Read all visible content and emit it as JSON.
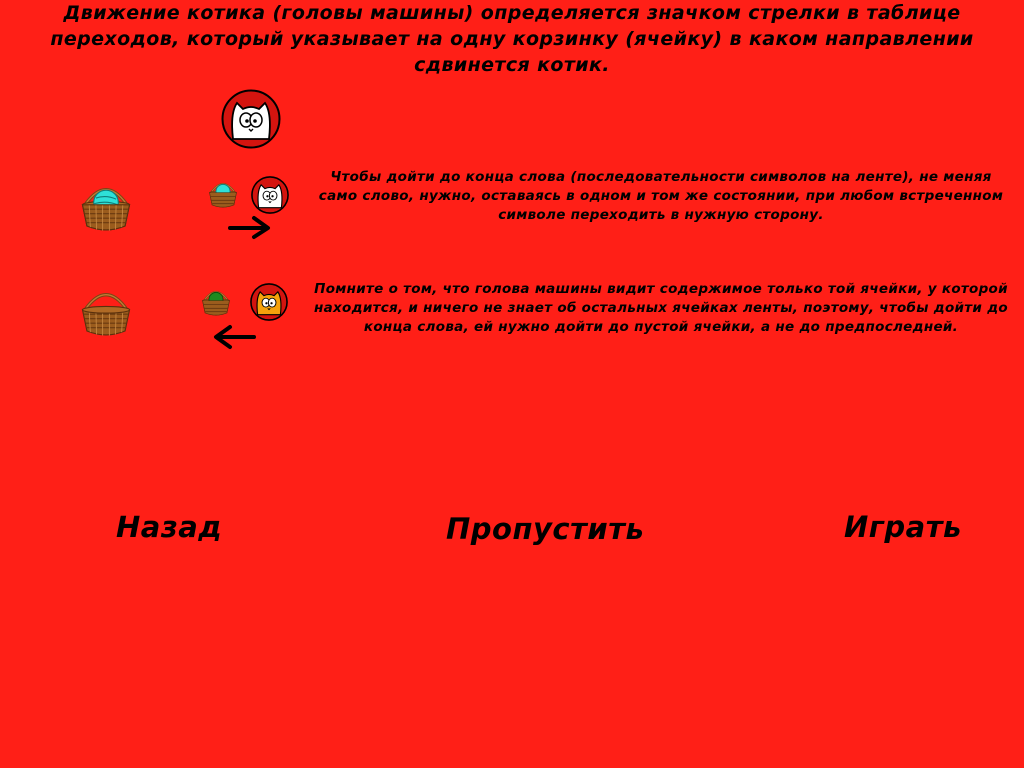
{
  "title": "Движение котика (головы машины) определяется значком стрелки в таблице переходов, который указывает на одну корзинку (ячейку) в каком направлении сдвинется котик.",
  "hints": [
    {
      "text": "Чтобы дойти до конца слова (последовательности символов на ленте), не меняя само слово, нужно, оставаясь в одном и том же состоянии, при любом встреченном символе переходить в нужную сторону.",
      "yarn_color": "#2ee0d8",
      "cat_color": "#ffffff",
      "arrow": "right-arrow"
    },
    {
      "text": "Помните о том, что голова машины видит содержимое только той ячейки, у которой находится, и ничего не знает об остальных ячейках ленты, поэтому, чтобы дойти до конца слова, ей нужно дойти до пустой ячейки, а не до предпоследней.",
      "yarn_color": "#1f8a1f",
      "cat_color": "#f6a20c",
      "arrow": "left-arrow"
    }
  ],
  "nav": {
    "back": "Назад",
    "skip": "Пропустить",
    "play": "Играть"
  },
  "colors": {
    "background": "#ff1f17",
    "cat_circle": "#d4140f"
  }
}
